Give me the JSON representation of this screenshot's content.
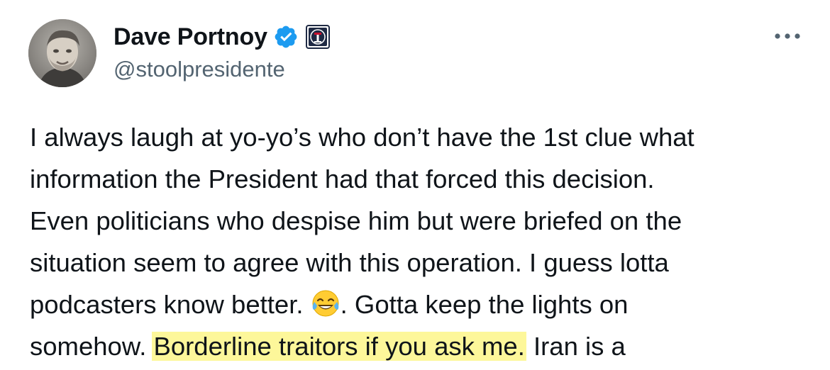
{
  "author": {
    "display_name": "Dave Portnoy",
    "handle": "@stoolpresidente",
    "verified_badge_icon": "verified-check-icon",
    "affiliate_badge_icon": "barstool-logo-icon",
    "verified_color": "#1d9bf0"
  },
  "more_button_icon": "more-horizontal-icon",
  "text": {
    "line1": "I always laugh at yo-yo’s who don’t have the 1st clue what",
    "line2": "information the President had that forced this decision.",
    "line3": "Even politicians who despise him but were briefed on the",
    "line4": "situation seem to agree with this operation.  I guess lotta",
    "line5_before_emoji": "podcasters know better. ",
    "line5_emoji_icon": "face-with-tears-of-joy-emoji",
    "line5_after_emoji": ".  Gotta keep the lights on",
    "line6_before": "somehow. ",
    "line6_highlight": "Borderline traitors if you ask me.",
    "line6_after": "  Iran is a",
    "highlight_color": "#fdf79a"
  }
}
